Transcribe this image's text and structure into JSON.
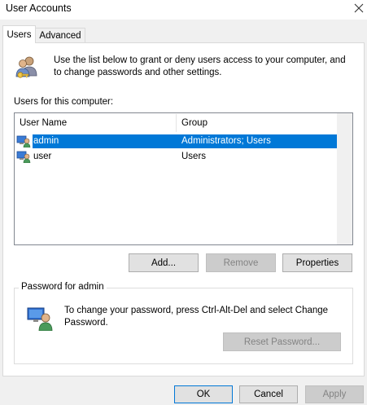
{
  "window": {
    "title": "User Accounts",
    "close_icon": "close-icon"
  },
  "tabs": [
    {
      "label": "Users",
      "selected": true
    },
    {
      "label": "Advanced",
      "selected": false
    }
  ],
  "intro": {
    "text": "Use the list below to grant or deny users access to your computer, and to change passwords and other settings.",
    "icon": "users-keys-icon"
  },
  "users_list": {
    "label": "Users for this computer:",
    "columns": [
      "User Name",
      "Group"
    ],
    "rows": [
      {
        "name": "admin",
        "group": "Administrators; Users",
        "selected": true,
        "icon": "admin-user-icon"
      },
      {
        "name": "user",
        "group": "Users",
        "selected": false,
        "icon": "user-icon"
      }
    ]
  },
  "list_buttons": {
    "add": "Add...",
    "remove": "Remove",
    "properties": "Properties"
  },
  "password_group": {
    "title": "Password for admin",
    "text": "To change your password, press Ctrl-Alt-Del and select Change Password.",
    "reset_button": "Reset Password...",
    "icon": "password-user-icon"
  },
  "dialog_buttons": {
    "ok": "OK",
    "cancel": "Cancel",
    "apply": "Apply"
  },
  "colors": {
    "selection": "#0078d7",
    "dialog_bg": "#f0f0f0"
  }
}
